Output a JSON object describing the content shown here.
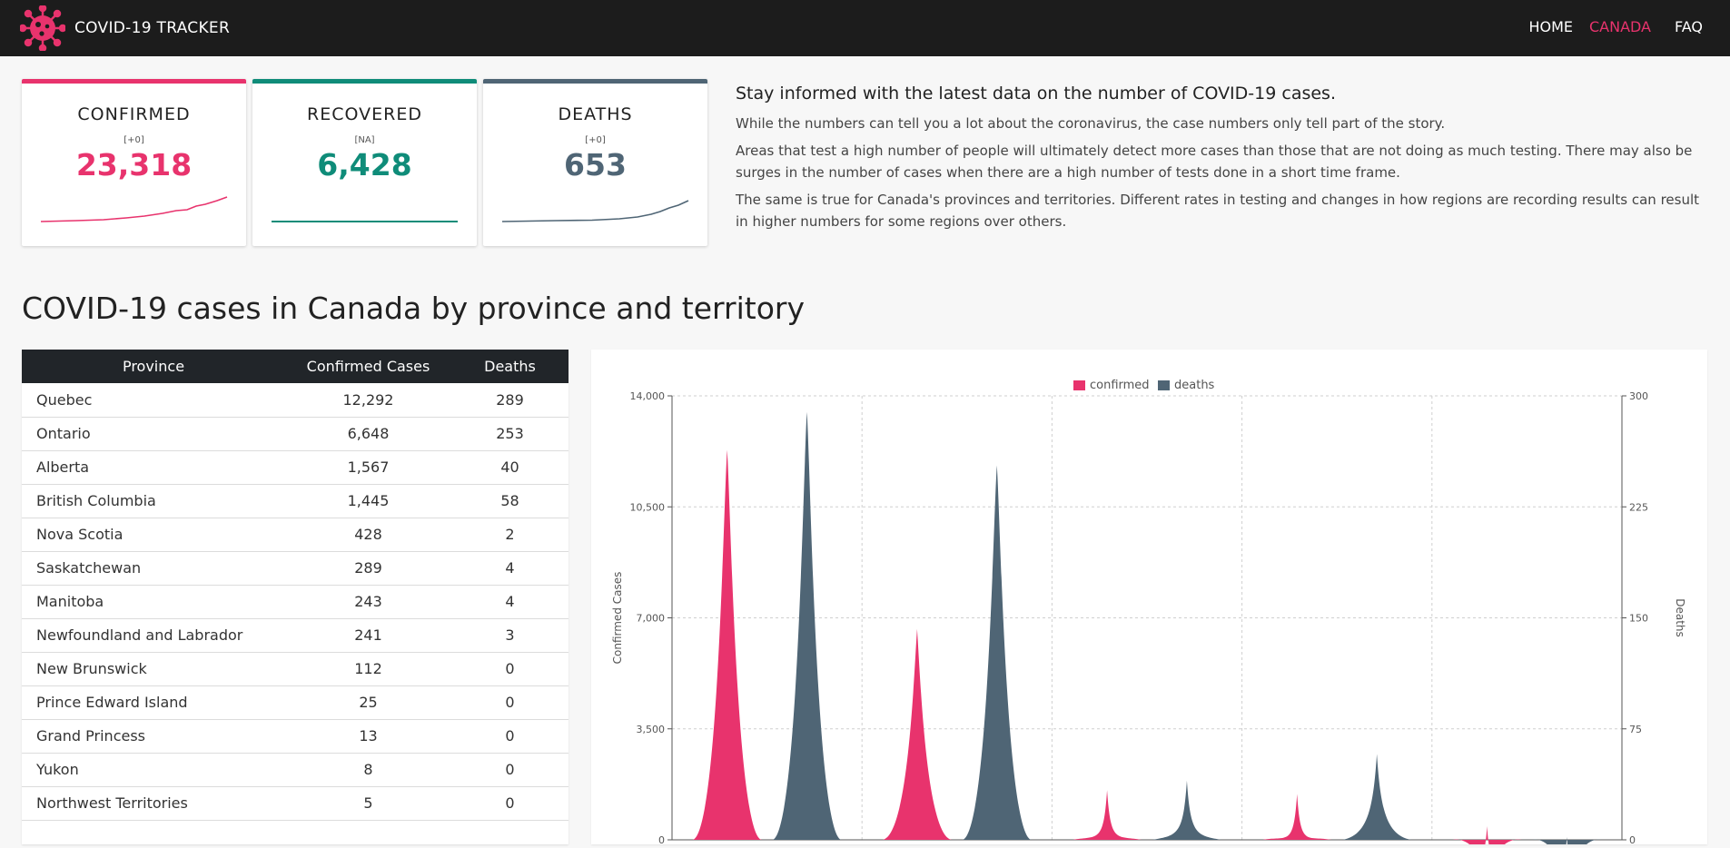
{
  "app": {
    "title": "COVID-19 TRACKER"
  },
  "nav": {
    "home": "HOME",
    "canada": "CANADA",
    "faq": "FAQ"
  },
  "colors": {
    "confirmed": "#e8336d",
    "recovered": "#0f8c79",
    "deaths": "#4f6575",
    "navbar": "#1c1c1c"
  },
  "cards": {
    "confirmed": {
      "title": "CONFIRMED",
      "delta": "[+0]",
      "value": "23,318"
    },
    "recovered": {
      "title": "RECOVERED",
      "delta": "[NA]",
      "value": "6,428"
    },
    "deaths": {
      "title": "DEATHS",
      "delta": "[+0]",
      "value": "653"
    }
  },
  "info": {
    "heading": "Stay informed with the latest data on the number of COVID-19 cases.",
    "p1": "While the numbers can tell you a lot about the coronavirus, the case numbers only tell part of the story.",
    "p2": "Areas that test a high number of people will ultimately detect more cases than those that are not doing as much testing. There may also be surges in the number of cases when there are a high number of tests done in a short time frame.",
    "p3": "The same is true for Canada's provinces and territories. Different rates in testing and changes in how regions are recording results can result in higher numbers for some regions over others."
  },
  "section": {
    "title": "COVID-19 cases in Canada by province and territory"
  },
  "table": {
    "headers": [
      "Province",
      "Confirmed Cases",
      "Deaths"
    ],
    "rows": [
      [
        "Quebec",
        "12,292",
        "289"
      ],
      [
        "Ontario",
        "6,648",
        "253"
      ],
      [
        "Alberta",
        "1,567",
        "40"
      ],
      [
        "British Columbia",
        "1,445",
        "58"
      ],
      [
        "Nova Scotia",
        "428",
        "2"
      ],
      [
        "Saskatchewan",
        "289",
        "4"
      ],
      [
        "Manitoba",
        "243",
        "4"
      ],
      [
        "Newfoundland and Labrador",
        "241",
        "3"
      ],
      [
        "New Brunswick",
        "112",
        "0"
      ],
      [
        "Prince Edward Island",
        "25",
        "0"
      ],
      [
        "Grand Princess",
        "13",
        "0"
      ],
      [
        "Yukon",
        "8",
        "0"
      ],
      [
        "Northwest Territories",
        "5",
        "0"
      ]
    ]
  },
  "chart_data": {
    "type": "area",
    "legend": [
      "confirmed",
      "deaths"
    ],
    "legend_position": "top-center",
    "ylabel": "Confirmed Cases",
    "y2label": "Deaths",
    "ylim": [
      0,
      14000
    ],
    "y2lim": [
      0,
      300
    ],
    "yticks": [
      "0",
      "3,500",
      "7,000",
      "10,500",
      "14,000"
    ],
    "y2ticks": [
      "0",
      "75",
      "150",
      "225",
      "300"
    ],
    "grid": true,
    "series": [
      {
        "name": "confirmed",
        "axis": "left",
        "values": [
          12292,
          6648,
          1567,
          1445,
          428
        ]
      },
      {
        "name": "deaths",
        "axis": "right",
        "values": [
          289,
          253,
          40,
          58,
          2
        ]
      }
    ]
  }
}
